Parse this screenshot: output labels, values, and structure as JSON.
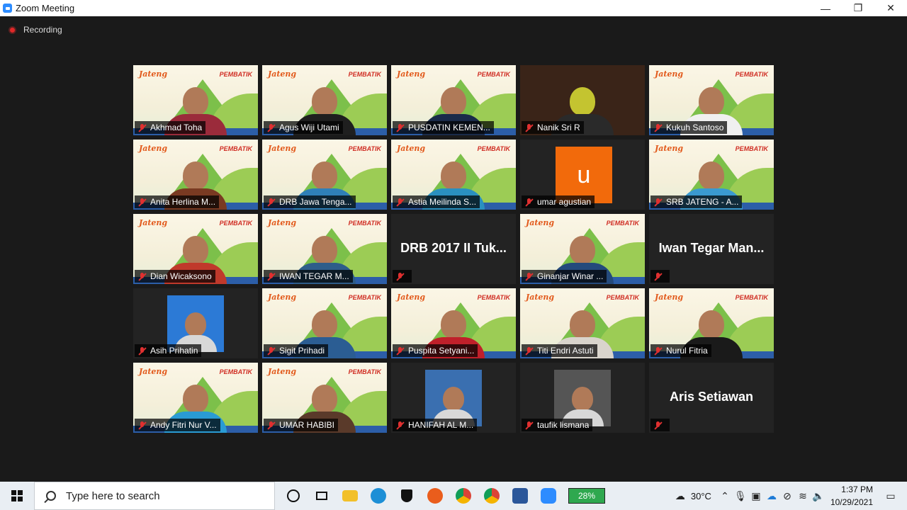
{
  "window": {
    "title": "Zoom Meeting",
    "minimize": "—",
    "restore": "❐",
    "close": "✕"
  },
  "recording": {
    "label": "Recording"
  },
  "participants": [
    {
      "name": "Akhmad Toha",
      "type": "video",
      "shirt": "#9b2b3b"
    },
    {
      "name": "Agus Wiji Utami",
      "type": "video",
      "shirt": "#1f1f1f"
    },
    {
      "name": "PUSDATIN KEMEN...",
      "type": "video",
      "shirt": "#1a2b4a",
      "active": true
    },
    {
      "name": "Nanik Sri R",
      "type": "video-dark",
      "shirt": "#c4c430"
    },
    {
      "name": "Kukuh Santoso",
      "type": "video",
      "shirt": "#f0f0f0"
    },
    {
      "name": "Anita Herlina M...",
      "type": "video",
      "shirt": "#7a3a22"
    },
    {
      "name": "DRB Jawa Tenga...",
      "type": "video",
      "shirt": "#2f80b8"
    },
    {
      "name": "Astia Meilinda S...",
      "type": "video",
      "shirt": "#2a90c0"
    },
    {
      "name": "umar agustian",
      "type": "avatar",
      "initial": "u"
    },
    {
      "name": "SRB JATENG - A...",
      "type": "video",
      "shirt": "#3a9ad0"
    },
    {
      "name": "Dian Wicaksono",
      "type": "video",
      "shirt": "#c0392b"
    },
    {
      "name": "IWAN TEGAR M...",
      "type": "video",
      "shirt": "#2e5d8a"
    },
    {
      "name": "DRB 2017 II Tuk...",
      "type": "name-only",
      "display": "DRB 2017 II Tuk..."
    },
    {
      "name": "Ginanjar Winar ...",
      "type": "video",
      "shirt": "#244a7c"
    },
    {
      "name": "Iwan Tegar Man...",
      "type": "name-only",
      "display": "Iwan Tegar Man..."
    },
    {
      "name": "Asih Prihatin",
      "type": "thumb",
      "shirt": "#2c7ad6"
    },
    {
      "name": "Sigit Prihadi",
      "type": "video",
      "shirt": "#2b5d93"
    },
    {
      "name": "Puspita Setyani...",
      "type": "video",
      "shirt": "#c0202a"
    },
    {
      "name": "Titi Endri Astuti",
      "type": "video",
      "shirt": "#d9d4cc"
    },
    {
      "name": "Nurul Fitria",
      "type": "video",
      "shirt": "#1a1a1a"
    },
    {
      "name": "Andy Fitri Nur V...",
      "type": "video",
      "shirt": "#2a9bd4"
    },
    {
      "name": "UMAR HABIBI",
      "type": "video",
      "shirt": "#5a3a2a"
    },
    {
      "name": "HANIFAH AL M...",
      "type": "thumb",
      "shirt": "#3a6fb0"
    },
    {
      "name": "taufik lismana",
      "type": "thumb",
      "shirt": "#555"
    },
    {
      "name": "Aris Setiawan",
      "type": "name-only",
      "display": "Aris Setiawan"
    }
  ],
  "background": {
    "logo_left": "Jateng",
    "logo_right": "PEMBATIK"
  },
  "taskbar": {
    "search_placeholder": "Type here to search",
    "battery": "28%",
    "temperature": "30°C",
    "time": "1:37 PM",
    "date": "10/29/2021"
  },
  "colors": {
    "accent": "#2d8cff",
    "active_speaker": "#b6e028",
    "muted": "#e03030",
    "avatar": "#f26a0b"
  }
}
